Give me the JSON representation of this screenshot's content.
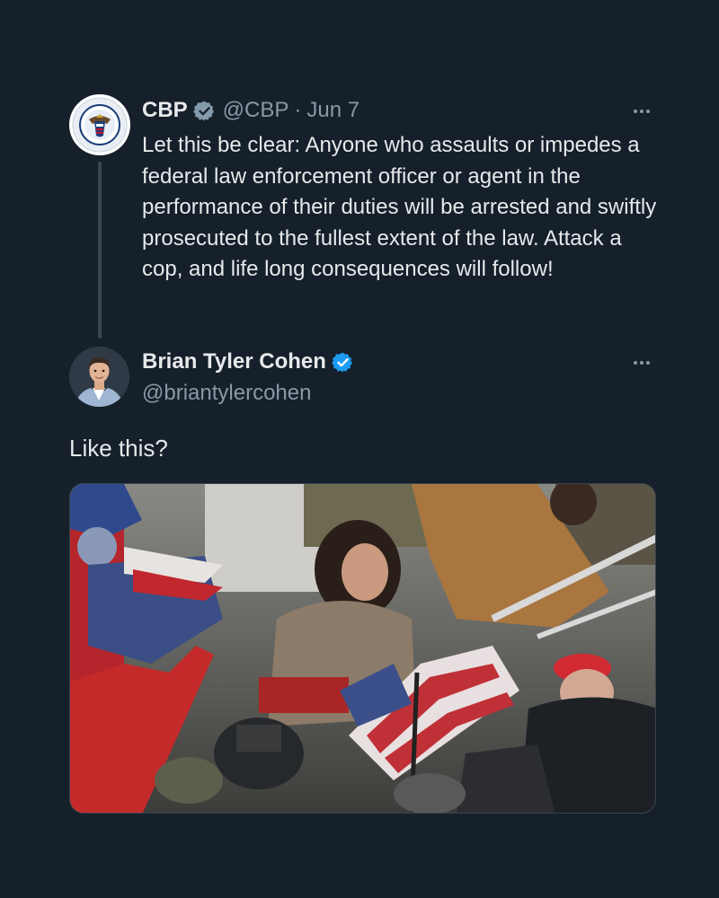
{
  "quoted_tweet": {
    "author_name": "CBP",
    "handle": "@CBP",
    "separator": "·",
    "date": "Jun 7",
    "verified_badge": "gray-check-icon",
    "text": "Let this be clear: Anyone who assaults or impedes a federal law enforcement officer or agent in the performance of their duties will be arrested and swiftly prosecuted to the fullest extent of the law. Attack a cop, and life long consequences will follow!",
    "avatar": "cbp-seal-icon"
  },
  "reply_tweet": {
    "author_name": "Brian Tyler Cohen",
    "handle": "@briantylercohen",
    "verified_badge": "blue-check-icon",
    "text": "Like this?",
    "avatar": "profile-photo",
    "media": "crowd-photo-image"
  },
  "colors": {
    "background": "#15202b",
    "text": "#e7e9ea",
    "muted": "#8b98a5",
    "verified_blue": "#1d9bf0",
    "verified_gray": "#829aab"
  }
}
